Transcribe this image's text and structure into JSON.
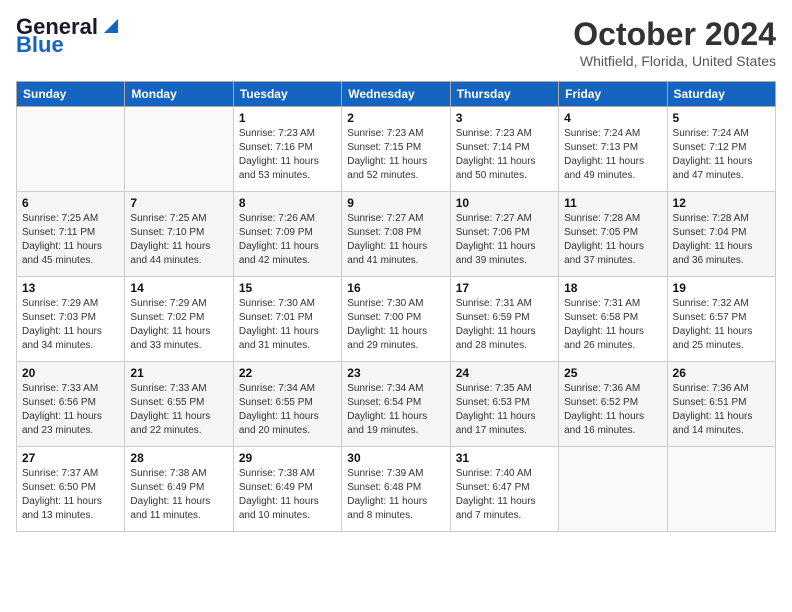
{
  "logo": {
    "general": "General",
    "blue": "Blue"
  },
  "title": "October 2024",
  "location": "Whitfield, Florida, United States",
  "headers": [
    "Sunday",
    "Monday",
    "Tuesday",
    "Wednesday",
    "Thursday",
    "Friday",
    "Saturday"
  ],
  "weeks": [
    [
      {
        "day": "",
        "info": ""
      },
      {
        "day": "",
        "info": ""
      },
      {
        "day": "1",
        "info": "Sunrise: 7:23 AM\nSunset: 7:16 PM\nDaylight: 11 hours and 53 minutes."
      },
      {
        "day": "2",
        "info": "Sunrise: 7:23 AM\nSunset: 7:15 PM\nDaylight: 11 hours and 52 minutes."
      },
      {
        "day": "3",
        "info": "Sunrise: 7:23 AM\nSunset: 7:14 PM\nDaylight: 11 hours and 50 minutes."
      },
      {
        "day": "4",
        "info": "Sunrise: 7:24 AM\nSunset: 7:13 PM\nDaylight: 11 hours and 49 minutes."
      },
      {
        "day": "5",
        "info": "Sunrise: 7:24 AM\nSunset: 7:12 PM\nDaylight: 11 hours and 47 minutes."
      }
    ],
    [
      {
        "day": "6",
        "info": "Sunrise: 7:25 AM\nSunset: 7:11 PM\nDaylight: 11 hours and 45 minutes."
      },
      {
        "day": "7",
        "info": "Sunrise: 7:25 AM\nSunset: 7:10 PM\nDaylight: 11 hours and 44 minutes."
      },
      {
        "day": "8",
        "info": "Sunrise: 7:26 AM\nSunset: 7:09 PM\nDaylight: 11 hours and 42 minutes."
      },
      {
        "day": "9",
        "info": "Sunrise: 7:27 AM\nSunset: 7:08 PM\nDaylight: 11 hours and 41 minutes."
      },
      {
        "day": "10",
        "info": "Sunrise: 7:27 AM\nSunset: 7:06 PM\nDaylight: 11 hours and 39 minutes."
      },
      {
        "day": "11",
        "info": "Sunrise: 7:28 AM\nSunset: 7:05 PM\nDaylight: 11 hours and 37 minutes."
      },
      {
        "day": "12",
        "info": "Sunrise: 7:28 AM\nSunset: 7:04 PM\nDaylight: 11 hours and 36 minutes."
      }
    ],
    [
      {
        "day": "13",
        "info": "Sunrise: 7:29 AM\nSunset: 7:03 PM\nDaylight: 11 hours and 34 minutes."
      },
      {
        "day": "14",
        "info": "Sunrise: 7:29 AM\nSunset: 7:02 PM\nDaylight: 11 hours and 33 minutes."
      },
      {
        "day": "15",
        "info": "Sunrise: 7:30 AM\nSunset: 7:01 PM\nDaylight: 11 hours and 31 minutes."
      },
      {
        "day": "16",
        "info": "Sunrise: 7:30 AM\nSunset: 7:00 PM\nDaylight: 11 hours and 29 minutes."
      },
      {
        "day": "17",
        "info": "Sunrise: 7:31 AM\nSunset: 6:59 PM\nDaylight: 11 hours and 28 minutes."
      },
      {
        "day": "18",
        "info": "Sunrise: 7:31 AM\nSunset: 6:58 PM\nDaylight: 11 hours and 26 minutes."
      },
      {
        "day": "19",
        "info": "Sunrise: 7:32 AM\nSunset: 6:57 PM\nDaylight: 11 hours and 25 minutes."
      }
    ],
    [
      {
        "day": "20",
        "info": "Sunrise: 7:33 AM\nSunset: 6:56 PM\nDaylight: 11 hours and 23 minutes."
      },
      {
        "day": "21",
        "info": "Sunrise: 7:33 AM\nSunset: 6:55 PM\nDaylight: 11 hours and 22 minutes."
      },
      {
        "day": "22",
        "info": "Sunrise: 7:34 AM\nSunset: 6:55 PM\nDaylight: 11 hours and 20 minutes."
      },
      {
        "day": "23",
        "info": "Sunrise: 7:34 AM\nSunset: 6:54 PM\nDaylight: 11 hours and 19 minutes."
      },
      {
        "day": "24",
        "info": "Sunrise: 7:35 AM\nSunset: 6:53 PM\nDaylight: 11 hours and 17 minutes."
      },
      {
        "day": "25",
        "info": "Sunrise: 7:36 AM\nSunset: 6:52 PM\nDaylight: 11 hours and 16 minutes."
      },
      {
        "day": "26",
        "info": "Sunrise: 7:36 AM\nSunset: 6:51 PM\nDaylight: 11 hours and 14 minutes."
      }
    ],
    [
      {
        "day": "27",
        "info": "Sunrise: 7:37 AM\nSunset: 6:50 PM\nDaylight: 11 hours and 13 minutes."
      },
      {
        "day": "28",
        "info": "Sunrise: 7:38 AM\nSunset: 6:49 PM\nDaylight: 11 hours and 11 minutes."
      },
      {
        "day": "29",
        "info": "Sunrise: 7:38 AM\nSunset: 6:49 PM\nDaylight: 11 hours and 10 minutes."
      },
      {
        "day": "30",
        "info": "Sunrise: 7:39 AM\nSunset: 6:48 PM\nDaylight: 11 hours and 8 minutes."
      },
      {
        "day": "31",
        "info": "Sunrise: 7:40 AM\nSunset: 6:47 PM\nDaylight: 11 hours and 7 minutes."
      },
      {
        "day": "",
        "info": ""
      },
      {
        "day": "",
        "info": ""
      }
    ]
  ]
}
